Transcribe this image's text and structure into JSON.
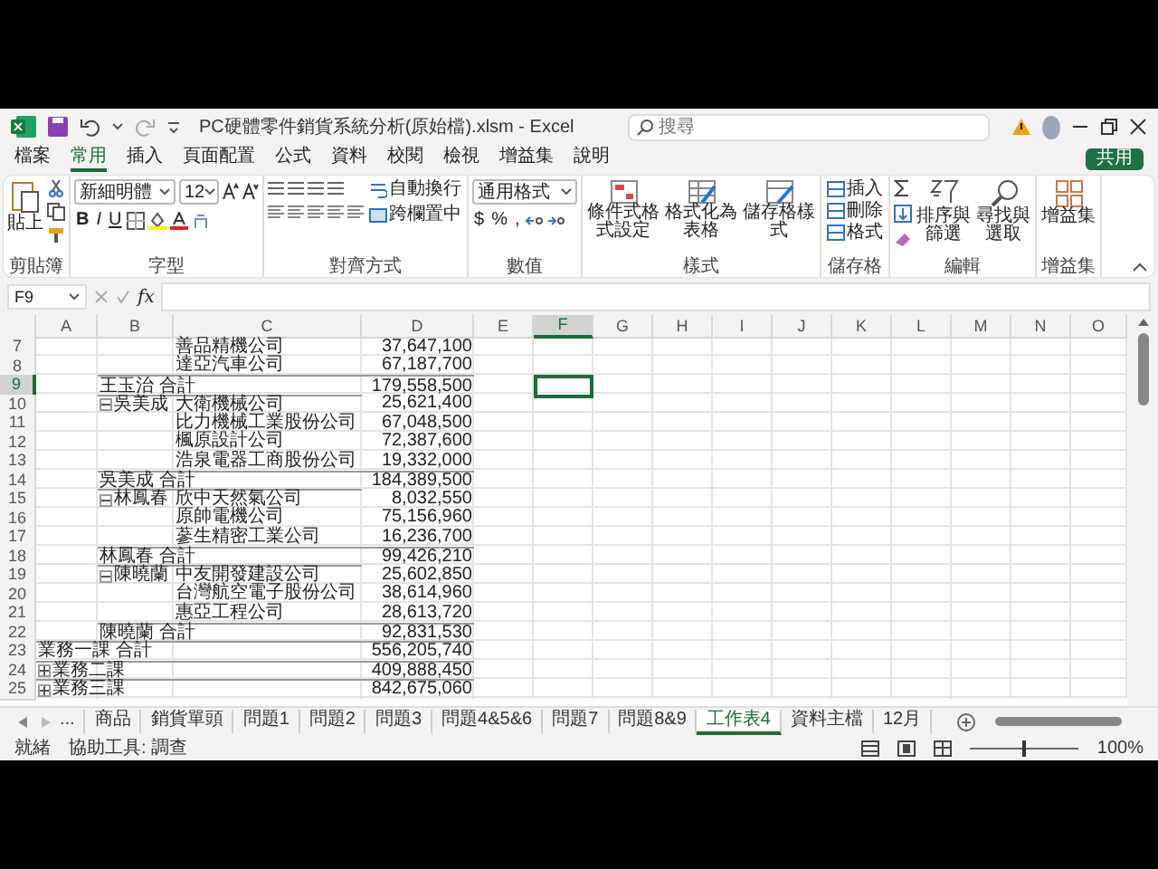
{
  "window": {
    "title": "PC硬體零件銷貨系統分析(原始檔).xlsm - Excel",
    "search_placeholder": "搜尋"
  },
  "ribbon_tabs": [
    {
      "label": "檔案",
      "selected": false
    },
    {
      "label": "常用",
      "selected": true
    },
    {
      "label": "插入",
      "selected": false
    },
    {
      "label": "頁面配置",
      "selected": false
    },
    {
      "label": "公式",
      "selected": false
    },
    {
      "label": "資料",
      "selected": false
    },
    {
      "label": "校閱",
      "selected": false
    },
    {
      "label": "檢視",
      "selected": false
    },
    {
      "label": "增益集",
      "selected": false
    },
    {
      "label": "說明",
      "selected": false
    }
  ],
  "share_button": "共用",
  "ribbon": {
    "clipboard": {
      "label": "剪貼簿",
      "paste": "貼上"
    },
    "font": {
      "label": "字型",
      "family": "新細明體",
      "size": "12",
      "style_buttons": [
        "B",
        "I",
        "U"
      ]
    },
    "alignment": {
      "label": "對齊方式",
      "wrap": "自動換行",
      "merge": "跨欄置中"
    },
    "number": {
      "label": "數值",
      "format": "通用格式",
      "symbols": [
        "$",
        "%",
        ","
      ]
    },
    "styles": {
      "label": "樣式",
      "buttons": [
        "條件式格式設定",
        "格式化為表格",
        "儲存格樣式"
      ]
    },
    "cells": {
      "label": "儲存格",
      "buttons": [
        "插入",
        "刪除",
        "格式"
      ]
    },
    "editing": {
      "label": "編輯",
      "buttons": [
        "排序與篩選",
        "尋找與選取"
      ]
    },
    "addins": {
      "label": "增益集",
      "button": "增益集"
    }
  },
  "formula_bar": {
    "name_box": "F9",
    "fx": "fx"
  },
  "columns": [
    {
      "label": "A",
      "selected": false
    },
    {
      "label": "B",
      "selected": false
    },
    {
      "label": "C",
      "selected": false
    },
    {
      "label": "D",
      "selected": false
    },
    {
      "label": "E",
      "selected": false
    },
    {
      "label": "F",
      "selected": true
    },
    {
      "label": "G",
      "selected": false
    },
    {
      "label": "H",
      "selected": false
    },
    {
      "label": "I",
      "selected": false
    },
    {
      "label": "J",
      "selected": false
    },
    {
      "label": "K",
      "selected": false
    },
    {
      "label": "L",
      "selected": false
    },
    {
      "label": "M",
      "selected": false
    },
    {
      "label": "N",
      "selected": false
    },
    {
      "label": "O",
      "selected": false
    }
  ],
  "rows": [
    {
      "number": "7",
      "kind": "item",
      "selected": false,
      "company": "善品精機公司",
      "amount": "37,647,100"
    },
    {
      "number": "8",
      "kind": "item",
      "selected": false,
      "company": "達亞汽車公司",
      "amount": "67,187,700"
    },
    {
      "number": "9",
      "kind": "person_total",
      "selected": true,
      "label": "王玉治 合計",
      "amount": "179,558,500"
    },
    {
      "number": "10",
      "kind": "person",
      "selected": false,
      "label": "吳美成",
      "expanded": true,
      "company": "大衛機械公司",
      "amount": "25,621,400"
    },
    {
      "number": "11",
      "kind": "item",
      "selected": false,
      "company": "比力機械工業股份公司",
      "amount": "67,048,500"
    },
    {
      "number": "12",
      "kind": "item",
      "selected": false,
      "company": "楓原設計公司",
      "amount": "72,387,600"
    },
    {
      "number": "13",
      "kind": "item",
      "selected": false,
      "company": "浩泉電器工商股份公司",
      "amount": "19,332,000"
    },
    {
      "number": "14",
      "kind": "person_total",
      "selected": false,
      "label": "吳美成 合計",
      "amount": "184,389,500"
    },
    {
      "number": "15",
      "kind": "person",
      "selected": false,
      "label": "林鳳春",
      "expanded": true,
      "company": "欣中天然氣公司",
      "amount": "8,032,550"
    },
    {
      "number": "16",
      "kind": "item",
      "selected": false,
      "company": "原帥電機公司",
      "amount": "75,156,960"
    },
    {
      "number": "17",
      "kind": "item",
      "selected": false,
      "company": "蔘生精密工業公司",
      "amount": "16,236,700"
    },
    {
      "number": "18",
      "kind": "person_total",
      "selected": false,
      "label": "林鳳春 合計",
      "amount": "99,426,210"
    },
    {
      "number": "19",
      "kind": "person",
      "selected": false,
      "label": "陳曉蘭",
      "expanded": true,
      "company": "中友開發建設公司",
      "amount": "25,602,850"
    },
    {
      "number": "20",
      "kind": "item",
      "selected": false,
      "company": "台灣航空電子股份公司",
      "amount": "38,614,960"
    },
    {
      "number": "21",
      "kind": "item",
      "selected": false,
      "company": "惠亞工程公司",
      "amount": "28,613,720"
    },
    {
      "number": "22",
      "kind": "person_total",
      "selected": false,
      "label": "陳曉蘭 合計",
      "amount": "92,831,530"
    },
    {
      "number": "23",
      "kind": "dept_total",
      "selected": false,
      "label": "業務一課 合計",
      "amount": "556,205,740"
    },
    {
      "number": "24",
      "kind": "dept",
      "selected": false,
      "label": "業務二課",
      "expanded": false,
      "amount": "409,888,450"
    },
    {
      "number": "25",
      "kind": "dept",
      "selected": false,
      "label": "業務三課",
      "expanded": false,
      "amount": "842,675,060"
    }
  ],
  "sheet_nav_more": "...",
  "sheet_tabs": [
    {
      "label": "商品",
      "selected": false
    },
    {
      "label": "銷貨單頭",
      "selected": false
    },
    {
      "label": "問題1",
      "selected": false
    },
    {
      "label": "問題2",
      "selected": false
    },
    {
      "label": "問題3",
      "selected": false
    },
    {
      "label": "問題4&5&6",
      "selected": false
    },
    {
      "label": "問題7",
      "selected": false
    },
    {
      "label": "問題8&9",
      "selected": false
    },
    {
      "label": "工作表4",
      "selected": true
    },
    {
      "label": "資料主檔",
      "selected": false
    },
    {
      "label": "12月",
      "selected": false
    }
  ],
  "status_bar": {
    "ready": "就緒",
    "accessibility": "協助工具: 調查",
    "zoom_slider": {
      "level": 0.5
    },
    "zoom": "100%"
  }
}
